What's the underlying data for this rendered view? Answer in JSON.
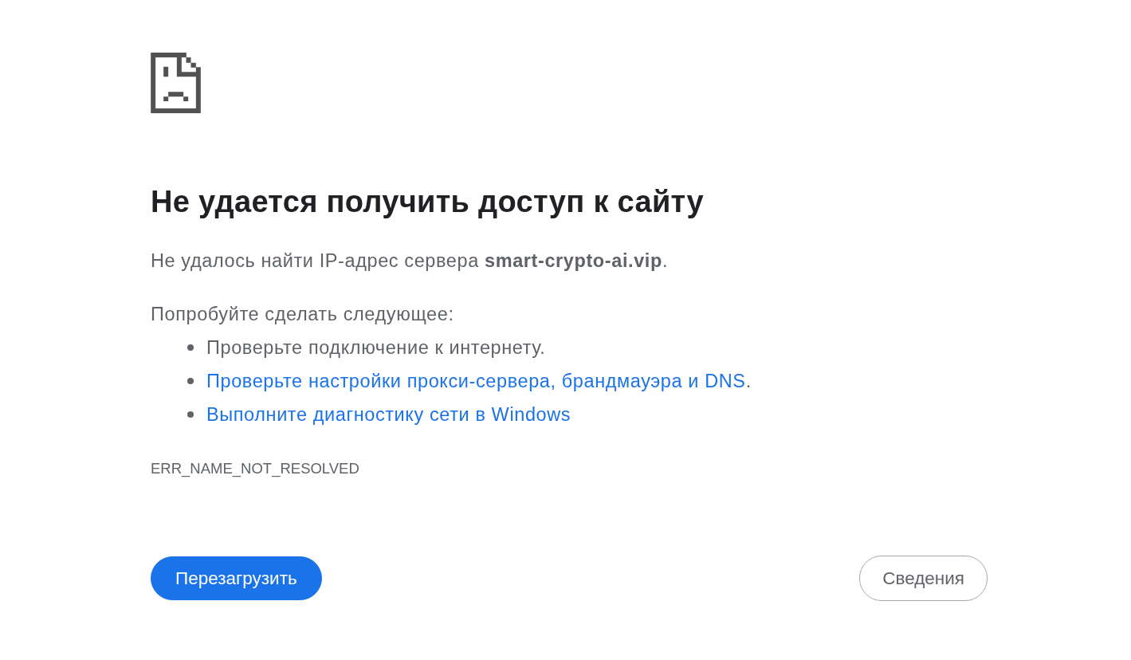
{
  "heading": "Не удается получить доступ к сайту",
  "summary": "Не удалось найти IP-адрес сервера **smart-crypto-ai.vip**.",
  "suggestions": {
    "intro": "Попробуйте сделать следующее:",
    "items": [
      {
        "kind": "text",
        "text": "Проверьте подключение к интернету."
      },
      {
        "kind": "link",
        "link": "Проверьте настройки прокси-сервера, брандмауэра и DNS",
        "after": "."
      },
      {
        "kind": "link",
        "link": "Выполните диагностику сети в Windows"
      }
    ]
  },
  "error_code": "ERR_NAME_NOT_RESOLVED",
  "buttons": [
    {
      "label": "Перезагрузить",
      "kind": "primary"
    },
    {
      "label": "Сведения",
      "kind": "secondary"
    }
  ]
}
